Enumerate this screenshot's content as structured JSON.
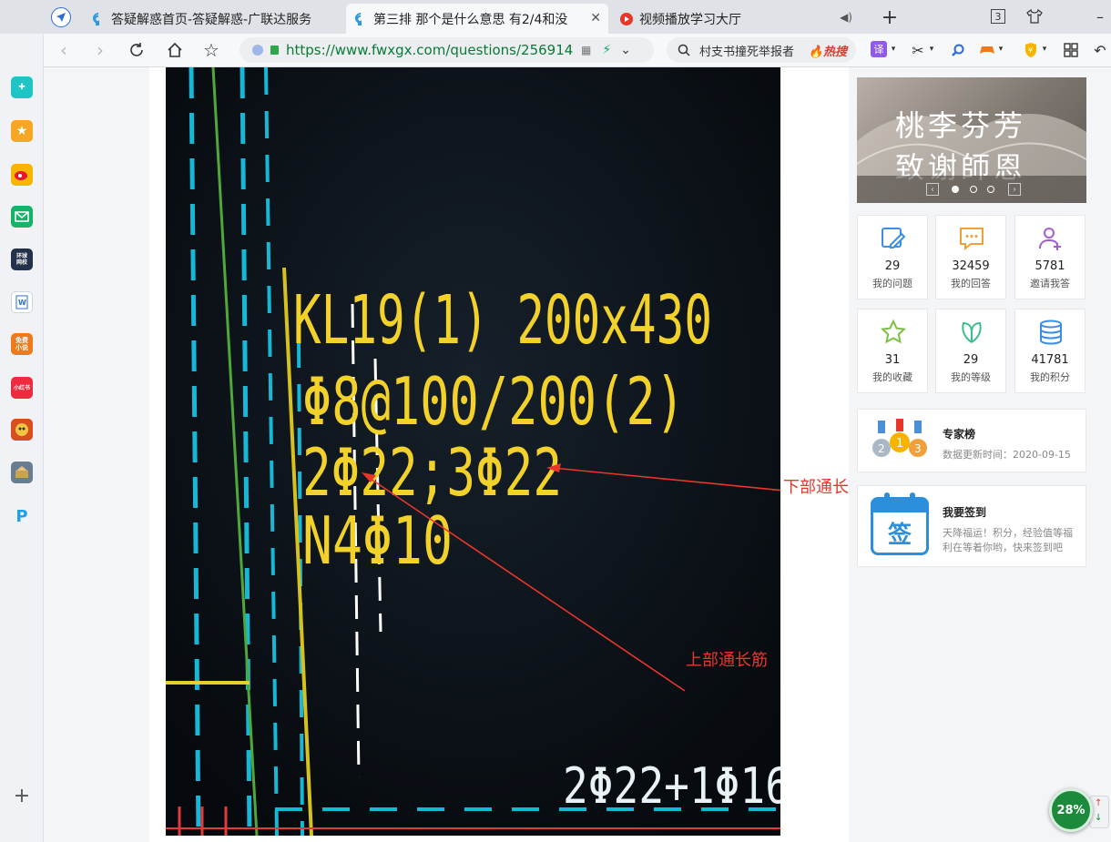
{
  "browser": {
    "tabs": [
      {
        "label": "答疑解惑首页-答疑解惑-广联达服务",
        "active": false
      },
      {
        "label": "第三排 那个是什么意思 有2/4和没",
        "active": true
      },
      {
        "label": "视频播放学习大厅",
        "active": false
      }
    ],
    "tab_count": "3",
    "url": "https://www.fwxgx.com/questions/256914",
    "search_text": "村支书撞死举报者",
    "search_hot": "热搜",
    "translate_label": "译"
  },
  "sidebar": {
    "items": [
      {
        "icon": "ie-logo-icon"
      },
      {
        "icon": "plus-app-icon"
      },
      {
        "icon": "star-favorites-icon"
      },
      {
        "icon": "weibo-icon"
      },
      {
        "icon": "mail-icon"
      },
      {
        "icon": "news-app-icon",
        "text": "环球\n网校"
      },
      {
        "icon": "word-doc-icon"
      },
      {
        "icon": "free-novel-icon",
        "text": "免费\n小说"
      },
      {
        "icon": "xiaohongshu-icon",
        "text": "小红书"
      },
      {
        "icon": "game-icon"
      },
      {
        "icon": "game-2-icon"
      },
      {
        "icon": "p-app-icon"
      }
    ]
  },
  "photo": {
    "drawing_lines": [
      "KL19(1) 200x430",
      "Φ8@100/200(2)",
      "2Φ22;3Φ22",
      "N4Φ10"
    ],
    "bottom_text": "2Φ22+1Φ16",
    "annotation_bottom_rebar": "下部通长筋",
    "annotation_top_rebar": "上部通长筋"
  },
  "banner": {
    "line1": "桃李芬芳",
    "line2": "致谢師恩",
    "dots": 3,
    "active_dot": 0
  },
  "stats": [
    {
      "icon": "edit-question-icon",
      "value": "29",
      "label": "我的问题",
      "color": "#3a8ee6"
    },
    {
      "icon": "comment-answer-icon",
      "value": "32459",
      "label": "我的回答",
      "color": "#f0a03a"
    },
    {
      "icon": "invite-user-icon",
      "value": "5781",
      "label": "邀请我答",
      "color": "#a25bd6"
    },
    {
      "icon": "star-collect-icon",
      "value": "31",
      "label": "我的收藏",
      "color": "#7bc043"
    },
    {
      "icon": "leaf-level-icon",
      "value": "29",
      "label": "我的等级",
      "color": "#3bbf8a"
    },
    {
      "icon": "coins-points-icon",
      "value": "41781",
      "label": "我的积分",
      "color": "#3a8ee6"
    }
  ],
  "expert_card": {
    "title": "专家榜",
    "desc": "数据更新时间：2020-09-15"
  },
  "signin_card": {
    "title": "我要签到",
    "desc": "天降福运！积分，经验值等福利在等着你哟，快来签到吧",
    "icon_text": "签"
  },
  "progress": {
    "value": "28%"
  },
  "colors": {
    "accent_green": "#1b8a3a",
    "annotation_red": "#e8362b",
    "cad_yellow": "#f2d22a"
  }
}
